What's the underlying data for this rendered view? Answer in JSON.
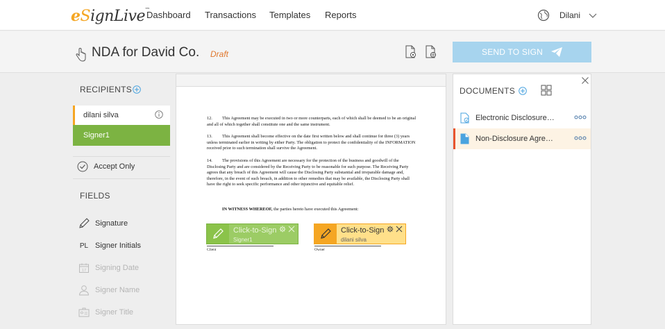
{
  "app": {
    "logo_prefix": "e",
    "logo_s": "S",
    "logo_rest": "ignLive",
    "logo_tm": "™"
  },
  "nav": {
    "items": [
      {
        "label": "Dashboard"
      },
      {
        "label": "Transactions"
      },
      {
        "label": "Templates"
      },
      {
        "label": "Reports"
      }
    ],
    "user_name": "Dilani"
  },
  "header": {
    "title": "NDA for David Co.",
    "status": "Draft",
    "send_label": "SEND TO SIGN"
  },
  "recipients": {
    "title": "RECIPIENTS",
    "recipient_name": "dilani silva",
    "signer_label": "Signer1",
    "accept_only": "Accept Only"
  },
  "fields": {
    "title": "FIELDS",
    "items": [
      {
        "label": "Signature",
        "icon": "pen-icon",
        "enabled": true
      },
      {
        "label": "Signer Initials",
        "icon": "initials-icon",
        "icon_text": "PL",
        "enabled": true
      },
      {
        "label": "Signing Date",
        "icon": "calendar-icon",
        "icon_text": "17",
        "enabled": false
      },
      {
        "label": "Signer Name",
        "icon": "person-icon",
        "enabled": false
      },
      {
        "label": "Signer Title",
        "icon": "title-card-icon",
        "enabled": false
      }
    ]
  },
  "document": {
    "clauses": [
      {
        "num": "12.",
        "text": "This Agreement may be executed in two or more counterparts, each of which shall be deemed to be an original and all of which together shall constitute one and the same instrument."
      },
      {
        "num": "13.",
        "text": "This Agreement shall become effective on the date first written below and shall continue for three (3) years unless terminated earlier in writing by either Party. The obligation to protect the confidentiality of the INFORMATION received prior to such termination shall survive the Agreement."
      },
      {
        "num": "14.",
        "text": "The provisions of this Agreement are necessary for the protection of the business and goodwill of the Disclosing Party and are considered by the Receiving Party to be reasonable for such purpose. The Receiving Party agrees that any breach of this Agreement will cause the Disclosing Party substantial and irreparable damage and, therefore, in the event of such breach, in addition to other remedies that may be available, the Disclosing Party shall have the right to seek specific performance and other injunctive and equitable relief."
      }
    ],
    "witness_bold": "IN WITNESS WHEREOF,",
    "witness_rest": " the parties hereto have executed this Agreement:",
    "signature_fields": [
      {
        "label": "Click-to-Sign",
        "signer": "Signer1",
        "caption": "Client",
        "color": "#8bc34a"
      },
      {
        "label": "Click-to-Sign",
        "signer": "dilani silva",
        "caption": "Owner",
        "color": "#f5a623"
      }
    ]
  },
  "documents_panel": {
    "title": "DOCUMENTS",
    "items": [
      {
        "label": "Electronic Disclosures and Signatures Consent",
        "selected": false
      },
      {
        "label": "Non-Disclosure Agreement",
        "selected": true
      }
    ]
  },
  "colors": {
    "brand_orange": "#f5a623",
    "signer_green": "#7cb342",
    "send_button": "#a7d4ee",
    "draft_orange": "#e0782e",
    "selected_doc_accent": "#e8542e"
  }
}
